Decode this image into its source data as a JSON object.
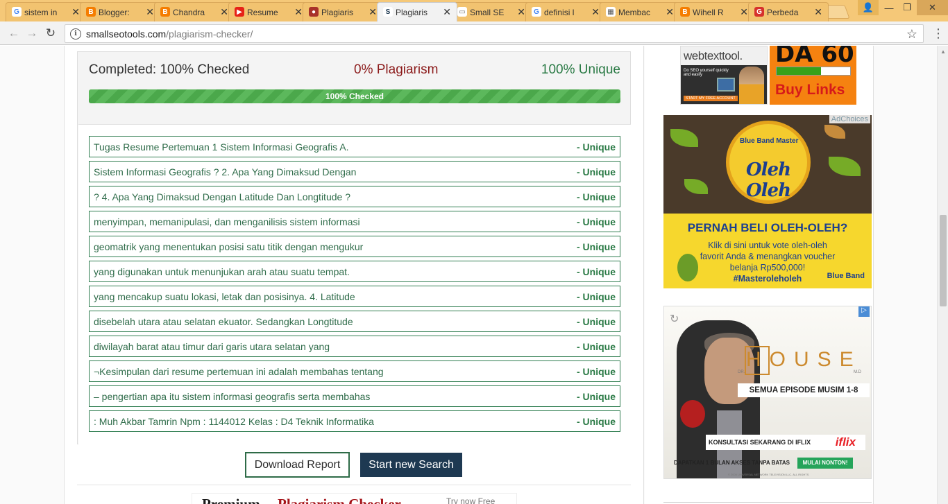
{
  "browser": {
    "tabs": [
      {
        "label": "sistem in",
        "icon": "google-icon",
        "active": false
      },
      {
        "label": "Blogger:",
        "icon": "blogger-icon",
        "active": false
      },
      {
        "label": "Chandra",
        "icon": "blogger-icon",
        "active": false
      },
      {
        "label": "Resume",
        "icon": "youtube-icon",
        "active": false
      },
      {
        "label": "Plagiaris",
        "icon": "apple-icon",
        "active": false
      },
      {
        "label": "Plagiaris",
        "icon": "smallseotools-icon",
        "active": true
      },
      {
        "label": "Small SE",
        "icon": "document-icon",
        "active": false
      },
      {
        "label": "definisi l",
        "icon": "google-icon",
        "active": false
      },
      {
        "label": "Membac",
        "icon": "tool-icon",
        "active": false
      },
      {
        "label": "Wihell R",
        "icon": "blogger-icon",
        "active": false
      },
      {
        "label": "Perbeda",
        "icon": "g-icon",
        "active": false
      }
    ],
    "tab_close_glyph": "✕",
    "url_host": "smallseotools.com",
    "url_path": "/plagiarism-checker/"
  },
  "results": {
    "completed_label": "Completed: 100% Checked",
    "plagiarism_label": "0% Plagiarism",
    "unique_label": "100% Unique",
    "progress_text": "100% Checked",
    "progress_fraction": 1.0,
    "status_colors": {
      "plagiarism": "#8b1a1a",
      "unique": "#2a7a45",
      "progress": "#5cb85c"
    },
    "sentences": [
      {
        "text": "Tugas Resume Pertemuan 1 Sistem Informasi Geografis A.",
        "status": "- Unique"
      },
      {
        "text": "Sistem Informasi Geografis ? 2. Apa Yang Dimaksud Dengan",
        "status": "- Unique"
      },
      {
        "text": "? 4. Apa Yang Dimaksud Dengan Latitude Dan Longtitude ?",
        "status": "- Unique"
      },
      {
        "text": "menyimpan, memanipulasi, dan menganilisis sistem informasi",
        "status": "- Unique"
      },
      {
        "text": "geomatrik yang menentukan posisi satu titik dengan mengukur",
        "status": "- Unique"
      },
      {
        "text": "yang digunakan untuk menunjukan arah atau suatu tempat.",
        "status": "- Unique"
      },
      {
        "text": "yang mencakup suatu lokasi, letak dan posisinya. 4. Latitude",
        "status": "- Unique"
      },
      {
        "text": "disebelah utara atau selatan ekuator. Sedangkan Longtitude",
        "status": "- Unique"
      },
      {
        "text": "diwilayah barat atau timur dari garis utara selatan yang",
        "status": "- Unique"
      },
      {
        "text": "¬Kesimpulan dari resume pertemuan ini adalah membahas tentang",
        "status": "- Unique"
      },
      {
        "text": "– pengertian apa itu sistem informasi geografis serta membahas",
        "status": "- Unique"
      },
      {
        "text": ": Muh Akbar Tamrin Npm : 1144012 Kelas : D4 Teknik Informatika",
        "status": "- Unique"
      }
    ],
    "download_label": "Download Report",
    "new_search_label": "Start new Search"
  },
  "promo": {
    "part1": "Premium",
    "part2": "Plagiarism Checker",
    "part3": "Try now Free"
  },
  "ads": {
    "webtext": {
      "logo": "webtexttool.",
      "tagline": "Do SEO yourself quickly and easily",
      "cta": "START MY FREE ACCOUNT"
    },
    "da60": {
      "title": "DA 60",
      "buy": "Buy Links",
      "bar_fraction": 0.6
    },
    "blueband": {
      "adchoices": "AdChoices",
      "brand": "Blue Band Master",
      "headline": "Oleh Oleh",
      "question": "PERNAH BELI OLEH-OLEH?",
      "body": "Klik di sini untuk vote oleh-oleh favorit Anda & menangkan voucher belanja Rp500,000!",
      "hashtag": "#Masteroleholeh",
      "logo": "Blue Band"
    },
    "house": {
      "dr": "DR.",
      "title": "HOUSE",
      "md": "M.D",
      "subtitle": "SEMUA EPISODE MUSIM 1-8",
      "cta": "KONSULTASI SEKARANG DI IFLIX",
      "brand": "iflix",
      "promo": "DAPATKAN 1 BULAN AKSES TANPA BATAS",
      "button": "MULAI NONTON!",
      "fine": "© 2004 UNIVERSAL NETWORK TELEVISION LLC. ALL RIGHTS"
    }
  }
}
